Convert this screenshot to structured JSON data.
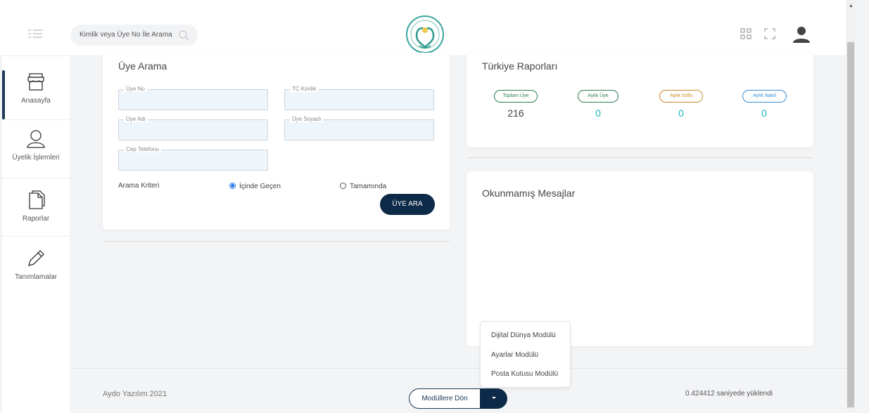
{
  "header": {
    "search_placeholder": "Kimlik veya Üye No İle Arama"
  },
  "sidebar": {
    "items": [
      {
        "label": "Anasayfa",
        "icon": "store-icon"
      },
      {
        "label": "Üyelik İşlemleri",
        "icon": "user-icon"
      },
      {
        "label": "Raporlar",
        "icon": "document-icon"
      },
      {
        "label": "Tanımlamalar",
        "icon": "pencil-icon"
      }
    ]
  },
  "member_search": {
    "title": "Üye Arama",
    "fields": {
      "member_no": "Üye No",
      "tc_identity": "TC Kimlik",
      "first_name": "Üye Adı",
      "last_name": "Üye Soyadı",
      "mobile": "Cep Telefonu"
    },
    "criteria_label": "Arama Kriteri",
    "criteria_options": [
      "İçinde Geçen",
      "Tamamında"
    ],
    "criteria_selected": "İçinde Geçen",
    "search_button": "ÜYE ARA"
  },
  "turkey_reports": {
    "title": "Türkiye Raporları",
    "stats": [
      {
        "label": "Toplam Üye",
        "value": "216",
        "color": "#2e7d4f",
        "value_color": "#444444"
      },
      {
        "label": "Aylık Üye",
        "value": "0",
        "color": "#2e7d4f",
        "value_color": "#1fb3c4"
      },
      {
        "label": "Aylık İstifa",
        "value": "0",
        "color": "#c98a2a",
        "value_color": "#1fb3c4"
      },
      {
        "label": "Aylık Nakil",
        "value": "0",
        "color": "#3a8fd4",
        "value_color": "#1fb3c4"
      }
    ]
  },
  "messages": {
    "title": "Okunmamış Mesajlar"
  },
  "module_menu": {
    "items": [
      "Dijital Dünya Modülü",
      "Ayarlar Modülü",
      "Posta Kutusu Modülü"
    ],
    "button_label": "Modüllere Dön"
  },
  "footer": {
    "copyright": "Aydo Yazılım 2021",
    "load_time": "0.424412 saniyede yüklendi"
  },
  "colors": {
    "primary": "#0d2a48",
    "accent": "#1fb3c4"
  }
}
